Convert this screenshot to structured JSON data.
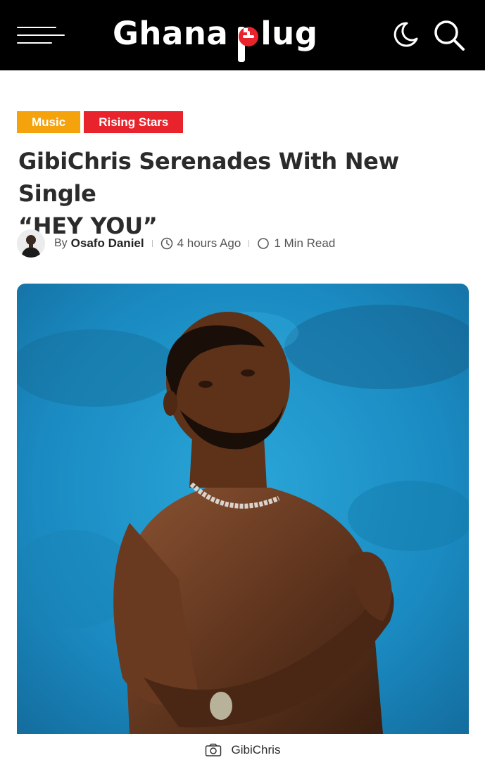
{
  "header": {
    "logo_word1": "Ghana",
    "logo_word2_rest": "lug",
    "logo_alt": "Ghana plug",
    "icons": [
      "menu-icon",
      "moon-icon",
      "search-icon"
    ]
  },
  "article": {
    "categories": [
      {
        "label": "Music",
        "color": "#f5a30d"
      },
      {
        "label": "Rising Stars",
        "color": "#e9232c"
      }
    ],
    "title_line1": "GibiChris Serenades With New Single",
    "title_line2": "“HEY YOU”",
    "meta": {
      "by_label": "By",
      "author": "Osafo Daniel",
      "time": "4 hours Ago",
      "read_time": "1 Min Read"
    },
    "image_caption": "GibiChris"
  },
  "colors": {
    "header_bg": "#000000",
    "accent_red": "#e9232c",
    "image_bg": "#1f8fc4"
  }
}
